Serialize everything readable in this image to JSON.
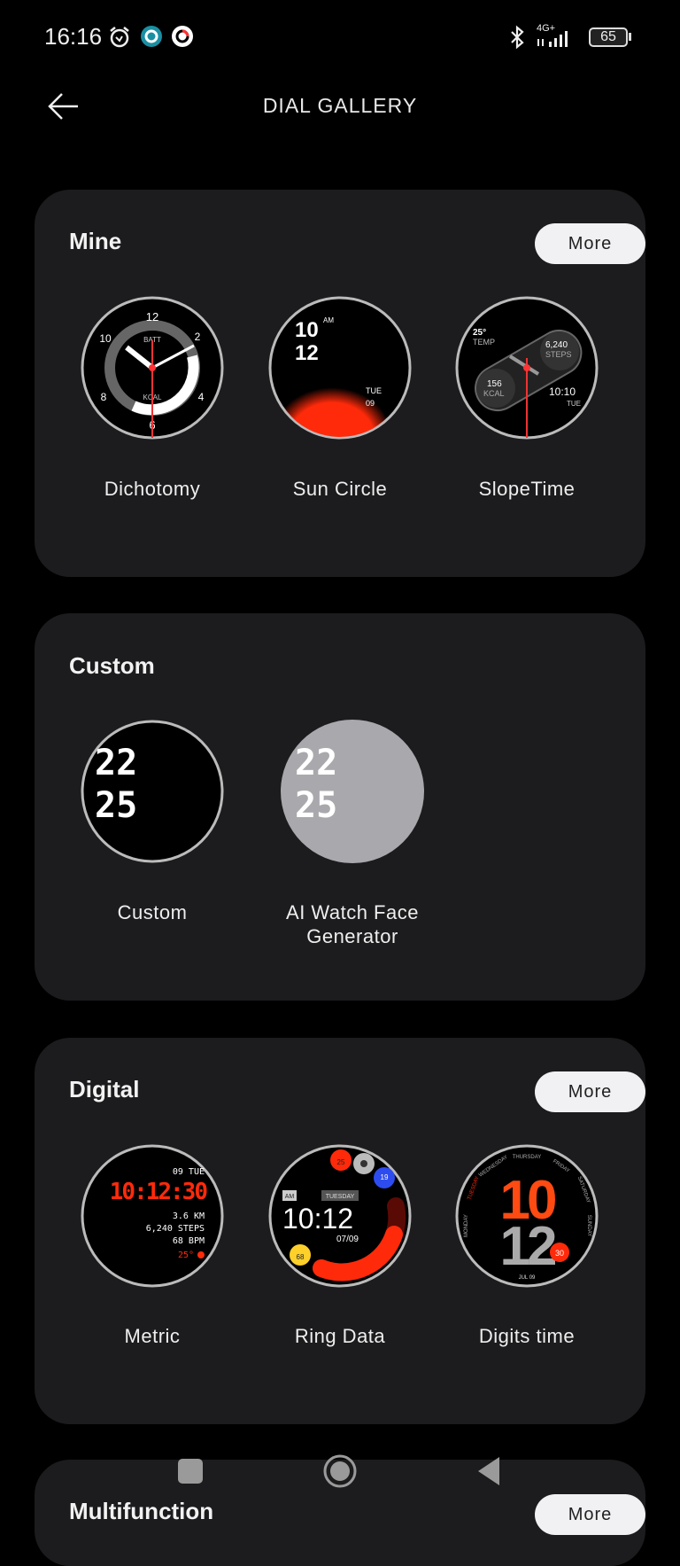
{
  "status_bar": {
    "time": "16:16",
    "network": "4G+",
    "battery": "65",
    "icons": [
      "alarm-icon",
      "settings-icon",
      "record-icon",
      "bluetooth-icon",
      "signal-icon",
      "battery-icon"
    ]
  },
  "header": {
    "title": "DIAL GALLERY",
    "back_icon": "arrow-left-icon"
  },
  "accent": "#ff3b1a",
  "sections": [
    {
      "title": "Mine",
      "more": "More",
      "items": [
        {
          "label": "Dichotomy",
          "face": {
            "numbers": [
              "12",
              "2",
              "4",
              "6",
              "8",
              "10"
            ],
            "batt": "BATT",
            "kcal": "KCAL"
          }
        },
        {
          "label": "Sun Circle",
          "face": {
            "hour": "10",
            "ampm": "AM",
            "minute": "12",
            "day": "TUE",
            "date": "09"
          }
        },
        {
          "label": "SlopeTime",
          "face": {
            "temp": "25°",
            "temp_label": "TEMP",
            "steps": "6,240",
            "steps_label": "STEPS",
            "kcal": "156",
            "kcal_label": "KCAL",
            "time": "10:10",
            "day": "TUE"
          }
        }
      ]
    },
    {
      "title": "Custom",
      "items": [
        {
          "label": "Custom",
          "face": {
            "hour": "22",
            "minute": "25"
          }
        },
        {
          "label": "AI Watch Face Generator",
          "face": {
            "hour": "22",
            "minute": "25"
          }
        }
      ]
    },
    {
      "title": "Digital",
      "more": "More",
      "items": [
        {
          "label": "Metric",
          "face": {
            "date": "09 TUE",
            "time": "10:12:30",
            "distance": "3.6 KM",
            "steps": "6,240 STEPS",
            "bpm": "68 BPM",
            "temp": "25°"
          }
        },
        {
          "label": "Ring Data",
          "face": {
            "ampm": "AM",
            "day": "TUESDAY",
            "time": "10:12",
            "date": "07/09",
            "high": "25",
            "low": "19",
            "heart": "68"
          }
        },
        {
          "label": "Digits time",
          "face": {
            "hour": "10",
            "minute": "12",
            "second": "30",
            "date": "JUL 09",
            "days": [
              "MONDAY",
              "TUESDAY",
              "WEDNESDAY",
              "THURSDAY",
              "FRIDAY",
              "SATURDAY",
              "SUNDAY"
            ]
          }
        }
      ]
    },
    {
      "title": "Multifunction",
      "more": "More"
    }
  ],
  "nav_bar": [
    "recents-button",
    "home-button",
    "back-button"
  ]
}
